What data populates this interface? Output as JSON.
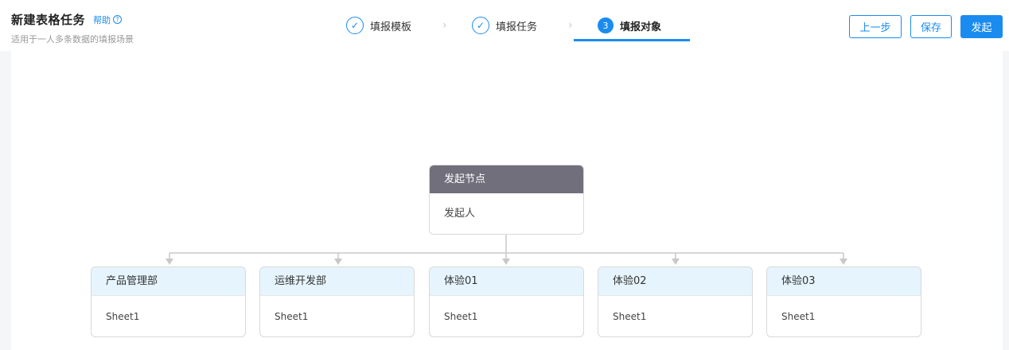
{
  "header": {
    "title": "新建表格任务",
    "help_label": "帮助",
    "help_icon": "?",
    "subtitle": "适用于一人多条数据的填报场景"
  },
  "steps": [
    {
      "index": "✓",
      "label": "填报模板",
      "state": "done"
    },
    {
      "index": "✓",
      "label": "填报任务",
      "state": "done"
    },
    {
      "index": "3",
      "label": "填报对象",
      "state": "active"
    }
  ],
  "step_separator": "›",
  "actions": {
    "prev_label": "上一步",
    "save_label": "保存",
    "submit_label": "发起"
  },
  "flow": {
    "root": {
      "title": "发起节点",
      "body": "发起人"
    },
    "children": [
      {
        "title": "产品管理部",
        "body": "Sheet1"
      },
      {
        "title": "运维开发部",
        "body": "Sheet1"
      },
      {
        "title": "体验01",
        "body": "Sheet1"
      },
      {
        "title": "体验02",
        "body": "Sheet1"
      },
      {
        "title": "体验03",
        "body": "Sheet1"
      }
    ]
  },
  "colors": {
    "accent": "#1a8cf0",
    "root_header": "#726f7c",
    "child_header": "#e6f4fd",
    "connector": "#c8c8c8"
  }
}
